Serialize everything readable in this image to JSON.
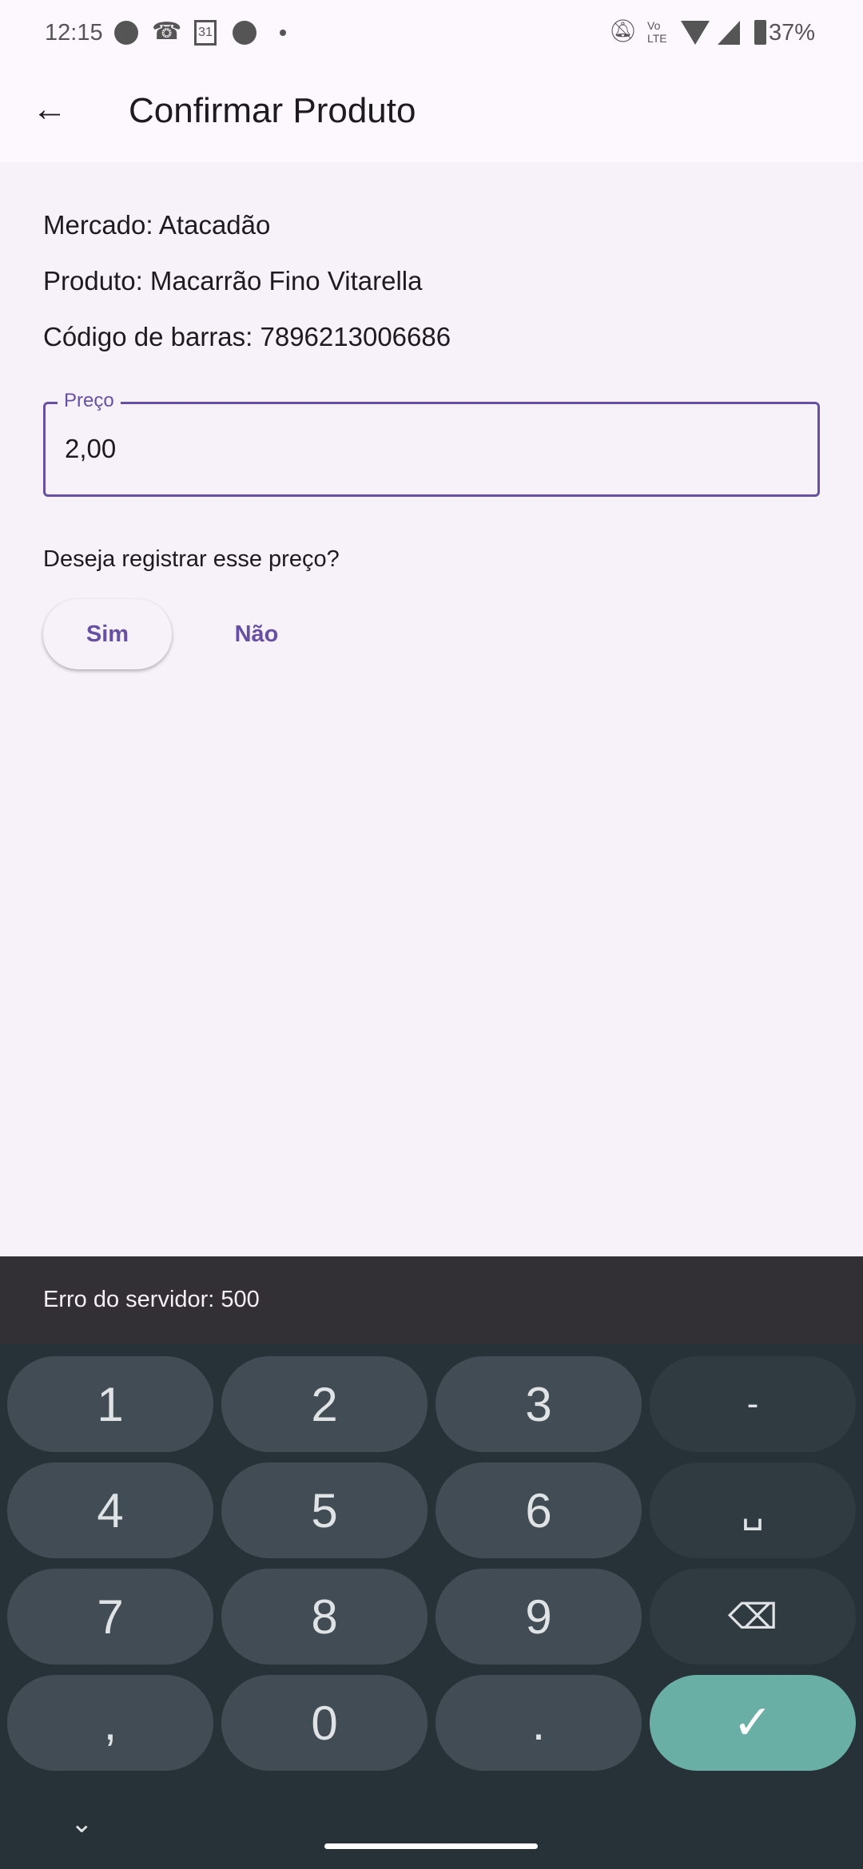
{
  "status_bar": {
    "time": "12:15",
    "battery": "37%",
    "icons": [
      "app-icon",
      "missed-call-icon",
      "calendar-icon",
      "pinterest-icon",
      "dot-icon",
      "bell-off-icon",
      "volte-icon",
      "wifi-icon",
      "signal-icon",
      "battery-charging-icon"
    ],
    "calendar_day": "31",
    "volte": "Vo LTE"
  },
  "app_bar": {
    "title": "Confirmar Produto",
    "back_icon": "arrow-back-icon"
  },
  "info": {
    "mercado": "Mercado: Atacadão",
    "produto": "Produto: Macarrão Fino Vitarella",
    "codigo": "Código de barras: 7896213006686"
  },
  "price_field": {
    "label": "Preço",
    "value": "2,00"
  },
  "question": "Deseja registrar esse preço?",
  "buttons": {
    "yes": "Sim",
    "no": "Não"
  },
  "snackbar": "Erro do servidor: 500",
  "keyboard": {
    "keys": [
      "1",
      "2",
      "3",
      "-",
      "4",
      "5",
      "6",
      "␣",
      "7",
      "8",
      "9",
      "⌫",
      ",",
      "0",
      ".",
      "✓"
    ]
  },
  "colors": {
    "accent": "#6750a4",
    "keyboard_bg": "#263238",
    "enter_key": "#6aafa6",
    "snackbar_bg": "#322f35"
  }
}
